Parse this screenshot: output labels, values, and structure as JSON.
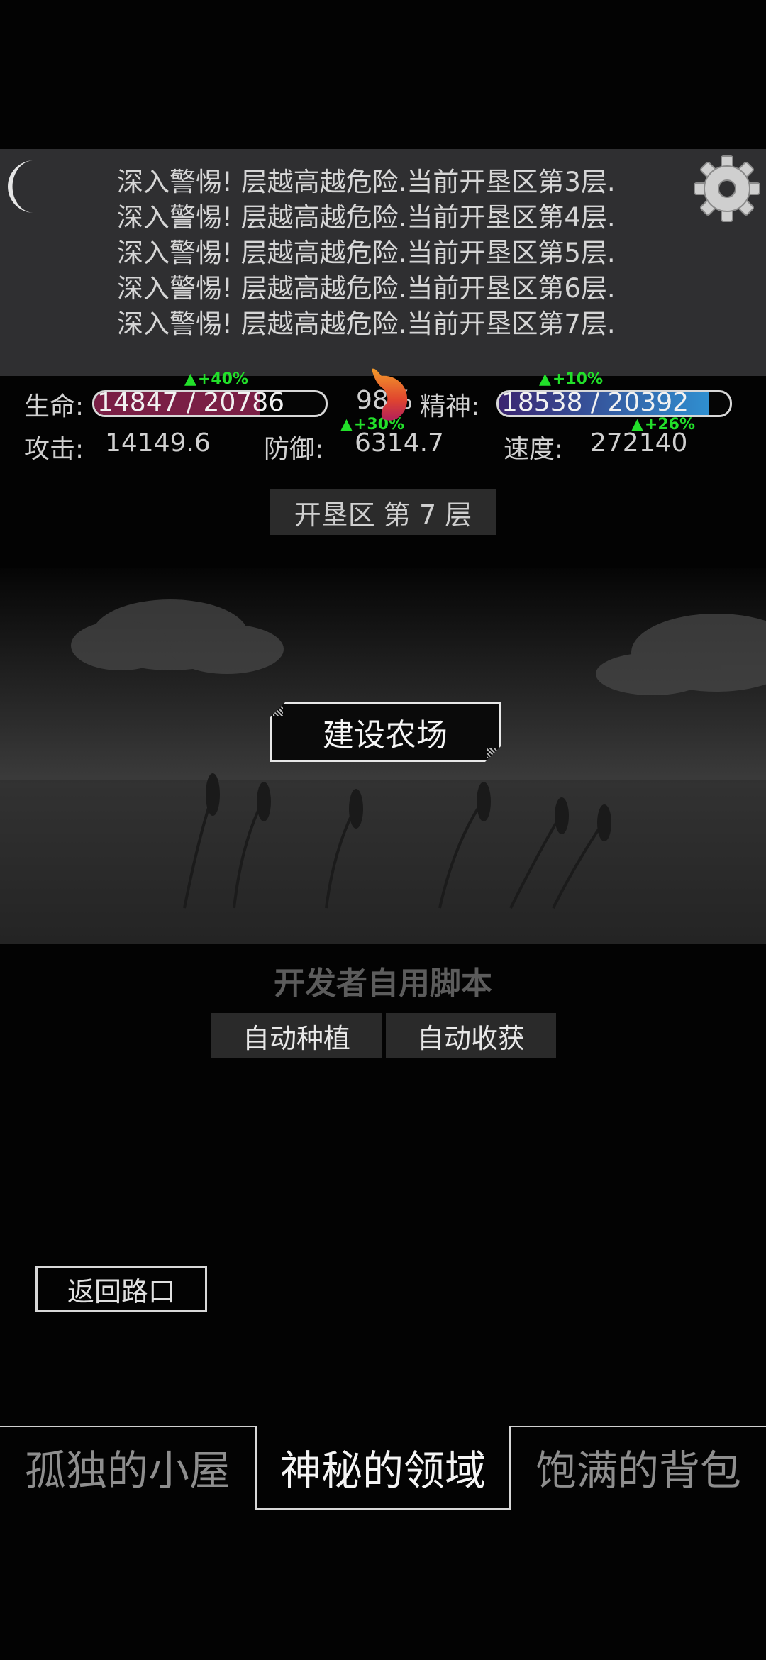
{
  "log": {
    "lines": [
      "深入警惕! 层越高越危险.当前开垦区第3层.",
      "深入警惕! 层越高越危险.当前开垦区第4层.",
      "深入警惕! 层越高越危险.当前开垦区第5层.",
      "深入警惕! 层越高越危险.当前开垦区第6层.",
      "深入警惕! 层越高越危险.当前开垦区第7层."
    ]
  },
  "stats": {
    "life_label": "生命:",
    "life_value": "14847 / 20786",
    "life_fraction": 0.714,
    "life_buff": "+40%",
    "hunger_value": "98%",
    "spirit_label": "精神:",
    "spirit_value": "18538 / 20392",
    "spirit_fraction": 0.909,
    "spirit_buff": "+10%",
    "attack_label": "攻击:",
    "attack_value": "14149.6",
    "defense_label": "防御:",
    "defense_value": "6314.7",
    "defense_buff": "+30%",
    "speed_label": "速度:",
    "speed_value": "272140",
    "speed_buff": "+26%"
  },
  "floor_label": "开垦区 第 7 层",
  "build_button": "建设农场",
  "dev": {
    "title": "开发者自用脚本",
    "auto_plant": "自动种植",
    "auto_harvest": "自动收获"
  },
  "back_button": "返回路口",
  "tabs": [
    "孤独的小屋",
    "神秘的领域",
    "饱满的背包"
  ],
  "colors": {
    "life_bar": "#7a1f45",
    "spirit_bar": "#2f8fd0",
    "buff_green": "#22e02a"
  }
}
